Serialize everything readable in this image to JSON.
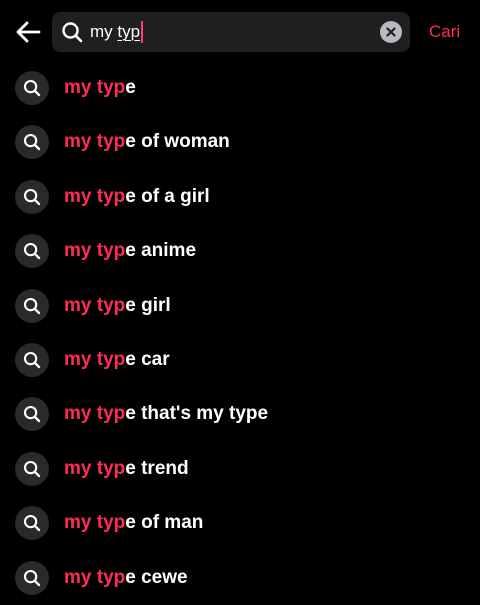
{
  "colors": {
    "accent": "#fe2c55",
    "background": "#000000",
    "search_bg": "#1f1f22",
    "icon_circle_bg": "#2a2a2d"
  },
  "header": {
    "back_icon": "arrow-left-icon",
    "search": {
      "icon": "search-icon",
      "value_prefix": "my ",
      "value_typed": "typ",
      "clear_icon": "clear-x-icon"
    },
    "submit_label": "Cari"
  },
  "suggestions": {
    "match": "my typ",
    "items": [
      {
        "icon": "search-icon",
        "highlight": "my typ",
        "rest": "e"
      },
      {
        "icon": "search-icon",
        "highlight": "my typ",
        "rest": "e of woman"
      },
      {
        "icon": "search-icon",
        "highlight": "my typ",
        "rest": "e of a girl"
      },
      {
        "icon": "search-icon",
        "highlight": "my typ",
        "rest": "e anime"
      },
      {
        "icon": "search-icon",
        "highlight": "my typ",
        "rest": "e girl"
      },
      {
        "icon": "search-icon",
        "highlight": "my typ",
        "rest": "e car"
      },
      {
        "icon": "search-icon",
        "highlight": "my typ",
        "rest": "e that's my type"
      },
      {
        "icon": "search-icon",
        "highlight": "my typ",
        "rest": "e trend"
      },
      {
        "icon": "search-icon",
        "highlight": "my typ",
        "rest": "e of man"
      },
      {
        "icon": "search-icon",
        "highlight": "my typ",
        "rest": "e cewe"
      }
    ]
  }
}
